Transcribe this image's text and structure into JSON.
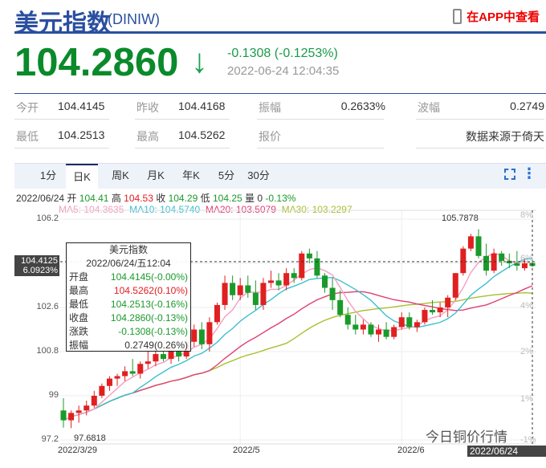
{
  "header": {
    "title": "美元指数",
    "code": "(DINIW)",
    "app_link": "在APP中查看",
    "price": "104.2860",
    "change": "-0.1308 (-0.1253%)",
    "time": "2022-06-24 12:04:35"
  },
  "stats": [
    {
      "label": "今开",
      "value": "104.4145"
    },
    {
      "label": "昨收",
      "value": "104.4168"
    },
    {
      "label": "振幅",
      "value": "0.2633%"
    },
    {
      "label": "波幅",
      "value": "0.2749"
    },
    {
      "label": "最低",
      "value": "104.2513"
    },
    {
      "label": "最高",
      "value": "104.5262"
    },
    {
      "label": "报价",
      "value": ""
    },
    {
      "label": "",
      "value": "数据来源于倚天"
    }
  ],
  "tabs": [
    "1分",
    "日K",
    "周K",
    "月K",
    "年K",
    "5分",
    "30分"
  ],
  "active_tab": "日K",
  "info": {
    "date": "2022/06/24",
    "open_l": "开",
    "open": "104.41",
    "high_l": "高",
    "high": "104.53",
    "close_l": "收",
    "close": "104.29",
    "low_l": "低",
    "low": "104.25",
    "vol_l": "量",
    "vol": "0",
    "pct": "-0.13%"
  },
  "ma": {
    "ma5": "MA5: 104.3635",
    "ma10": "MA10: 104.5740",
    "ma20": "MA20: 103.5079",
    "ma30": "MA30: 103.2297"
  },
  "tooltip": {
    "title": "美元指数",
    "date": "2022/06/24/五12:04",
    "rows": [
      {
        "label": "开盘",
        "value": "104.4145(-0.00%)",
        "color": "#1a9a2a"
      },
      {
        "label": "最高",
        "value": "104.5262(0.10%)",
        "color": "#e02020"
      },
      {
        "label": "最低",
        "value": "104.2513(-0.16%)",
        "color": "#1a9a2a"
      },
      {
        "label": "收盘",
        "value": "104.2860(-0.13%)",
        "color": "#1a9a2a"
      },
      {
        "label": "涨跌",
        "value": "-0.1308(-0.13%)",
        "color": "#1a9a2a"
      },
      {
        "label": "振幅",
        "value": "0.2749(0.26%)",
        "color": "#333"
      }
    ]
  },
  "crosshair": {
    "price": "104.4125",
    "pct": "6.0923%",
    "time": "2022/06/24 12:04"
  },
  "watermark": "今日铜价行情",
  "chart_data": {
    "type": "candlestick",
    "y_ticks": [
      "106.2",
      "104.4",
      "102.6",
      "100.8",
      "99",
      "97.2"
    ],
    "right_ticks": [
      "8%",
      "6%",
      "4%",
      "2%",
      "1%",
      "-1%"
    ],
    "x_labels": [
      "2022/3/29",
      "2022/5",
      "2022/6"
    ],
    "ylim": [
      97.2,
      106.2
    ],
    "max_label": "105.7878",
    "min_label": "97.6818",
    "colors": {
      "up": "#e02020",
      "down": "#1a9a2a",
      "ma5": "#f59ec0",
      "ma10": "#3bbfcf",
      "ma20": "#e04070",
      "ma30": "#a8c030"
    },
    "ohlc": [
      [
        98.4,
        98.9,
        97.7,
        98.0
      ],
      [
        98.0,
        98.4,
        97.68,
        98.3
      ],
      [
        98.3,
        98.6,
        97.9,
        98.4
      ],
      [
        98.4,
        98.8,
        98.2,
        98.6
      ],
      [
        98.6,
        99.2,
        98.5,
        99.0
      ],
      [
        99.0,
        99.5,
        98.9,
        99.4
      ],
      [
        99.4,
        99.8,
        99.2,
        99.7
      ],
      [
        99.7,
        99.9,
        99.4,
        99.8
      ],
      [
        99.8,
        100.2,
        99.6,
        100.0
      ],
      [
        100.0,
        100.5,
        99.8,
        99.9
      ],
      [
        99.9,
        100.4,
        99.7,
        100.3
      ],
      [
        100.3,
        100.8,
        100.1,
        100.4
      ],
      [
        100.4,
        100.9,
        100.2,
        100.7
      ],
      [
        100.7,
        101.0,
        100.4,
        100.5
      ],
      [
        100.5,
        101.0,
        100.3,
        100.9
      ],
      [
        100.9,
        101.1,
        100.4,
        100.6
      ],
      [
        100.6,
        101.4,
        100.5,
        101.2
      ],
      [
        101.2,
        101.9,
        101.0,
        101.7
      ],
      [
        101.7,
        102.0,
        100.9,
        101.1
      ],
      [
        101.1,
        102.2,
        100.8,
        102.0
      ],
      [
        102.0,
        102.8,
        101.9,
        102.7
      ],
      [
        102.7,
        103.9,
        102.5,
        103.6
      ],
      [
        103.6,
        103.9,
        102.9,
        103.1
      ],
      [
        103.1,
        103.8,
        102.9,
        103.5
      ],
      [
        103.5,
        103.9,
        103.0,
        103.2
      ],
      [
        103.2,
        103.7,
        102.5,
        102.7
      ],
      [
        102.7,
        103.8,
        102.5,
        103.6
      ],
      [
        103.6,
        104.1,
        103.4,
        103.7
      ],
      [
        103.7,
        104.0,
        103.3,
        103.5
      ],
      [
        103.5,
        104.2,
        103.3,
        104.0
      ],
      [
        104.0,
        104.2,
        103.6,
        103.8
      ],
      [
        103.8,
        104.9,
        103.7,
        104.8
      ],
      [
        104.8,
        105.0,
        104.4,
        104.6
      ],
      [
        104.6,
        104.9,
        103.8,
        103.9
      ],
      [
        103.9,
        104.0,
        103.2,
        103.4
      ],
      [
        103.4,
        103.8,
        102.5,
        102.9
      ],
      [
        102.9,
        103.3,
        102.2,
        102.3
      ],
      [
        102.3,
        102.6,
        101.7,
        101.9
      ],
      [
        101.9,
        102.3,
        101.5,
        101.7
      ],
      [
        101.7,
        102.1,
        101.5,
        101.9
      ],
      [
        101.9,
        102.0,
        101.4,
        101.5
      ],
      [
        101.5,
        101.9,
        101.2,
        101.7
      ],
      [
        101.7,
        102.0,
        101.3,
        101.4
      ],
      [
        101.4,
        101.9,
        101.3,
        101.8
      ],
      [
        101.8,
        102.4,
        101.7,
        102.2
      ],
      [
        102.2,
        102.4,
        101.7,
        101.8
      ],
      [
        101.8,
        102.1,
        101.6,
        102.0
      ],
      [
        102.0,
        102.6,
        101.9,
        102.5
      ],
      [
        102.5,
        102.9,
        102.3,
        102.4
      ],
      [
        102.4,
        102.8,
        102.2,
        102.6
      ],
      [
        102.6,
        103.1,
        102.2,
        103.0
      ],
      [
        103.0,
        104.0,
        102.9,
        104.0
      ],
      [
        104.0,
        105.1,
        103.9,
        105.0
      ],
      [
        105.0,
        105.6,
        104.9,
        105.5
      ],
      [
        105.5,
        105.79,
        104.6,
        104.7
      ],
      [
        104.7,
        105.2,
        103.9,
        104.1
      ],
      [
        104.1,
        105.0,
        104.0,
        104.8
      ],
      [
        104.8,
        104.9,
        104.3,
        104.5
      ],
      [
        104.5,
        104.8,
        104.2,
        104.4
      ],
      [
        104.4,
        104.9,
        104.1,
        104.3
      ],
      [
        104.2,
        104.6,
        104.1,
        104.4
      ],
      [
        104.41,
        104.53,
        104.25,
        104.29
      ]
    ]
  }
}
